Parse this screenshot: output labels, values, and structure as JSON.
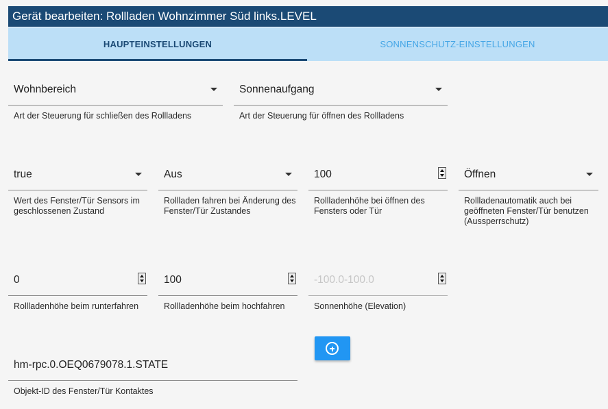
{
  "window": {
    "title": "Gerät bearbeiten: Rollladen Wohnzimmer Süd links.LEVEL"
  },
  "tabs": [
    {
      "label": "HAUPTEINSTELLUNGEN",
      "active": true
    },
    {
      "label": "SONNENSCHUTZ-EINSTELLUNGEN",
      "active": false
    }
  ],
  "fields": {
    "close_control": {
      "value": "Wohnbereich",
      "helper": "Art der Steuerung für schließen des Rollladens"
    },
    "open_control": {
      "value": "Sonnenaufgang",
      "helper": "Art der Steuerung für öffnen des Rollladens"
    },
    "sensor_closed_value": {
      "value": "true",
      "helper": "Wert des Fenster/Tür Sensors im geschlossenen Zustand"
    },
    "move_on_change": {
      "value": "Aus",
      "helper": "Rollladen fahren bei Änderung des Fenster/Tür Zustandes"
    },
    "height_on_open": {
      "value": "100",
      "helper": "Rollladenhöhe bei öffnen des Fensters oder Tür"
    },
    "automatic_open": {
      "value": "Öffnen",
      "helper": "Rollladenautomatik auch bei geöffneten Fenster/Tür benutzen (Aussperrschutz)"
    },
    "height_down": {
      "value": "0",
      "helper": "Rollladenhöhe beim runterfahren"
    },
    "height_up": {
      "value": "100",
      "helper": "Rollladenhöhe beim hochfahren"
    },
    "sun_elevation": {
      "placeholder": "-100.0-100.0",
      "helper": "Sonnenhöhe (Elevation)"
    },
    "contact_object_id": {
      "value": "hm-rpc.0.OEQ0679078.1.STATE",
      "helper": "Objekt-ID des Fenster/Tür Kontaktes"
    }
  },
  "buttons": {
    "add_icon": "plus-circle-icon"
  },
  "colors": {
    "title_bar": "#1b4a75",
    "tab_bar": "#bcdff7",
    "accent": "#2196f3"
  }
}
